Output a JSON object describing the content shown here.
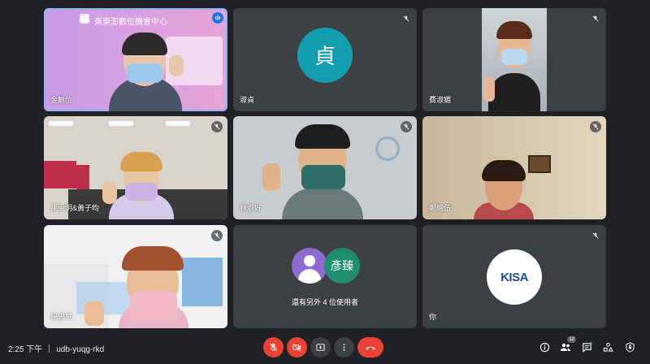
{
  "tiles": [
    {
      "name": "金數位",
      "banner": "東東澎數位機會中心"
    },
    {
      "name": "淑貞",
      "initial": "貞"
    },
    {
      "name": "費淑媚"
    },
    {
      "name": "孫園明&黃子昀"
    },
    {
      "name": "林淑好"
    },
    {
      "name": "鄭絢伍"
    },
    {
      "name": "楊思華"
    },
    {
      "others_initial": "彥臻",
      "others_text": "還有另外 4 位使用者"
    },
    {
      "name": "你",
      "logo": "KISA"
    }
  ],
  "bottom": {
    "time": "2:25 下午",
    "meeting_code": "udb-yuqg-rkd",
    "participant_count": "12"
  },
  "icons": {
    "tile_mute": "mic-off-icon",
    "speaking": "audio-level-icon",
    "controls": [
      "mic-off-icon",
      "camera-off-icon",
      "present-screen-icon",
      "more-options-icon",
      "hang-up-icon"
    ],
    "right": [
      "info-icon",
      "people-icon",
      "chat-icon",
      "activities-icon",
      "host-controls-icon"
    ]
  },
  "colors": {
    "background": "#202124",
    "tile": "#3c4043",
    "danger": "#ea4335",
    "active_border": "#8ab4f8",
    "avatar_teal": "#129eaf",
    "avatar_green": "#1e8e6e",
    "avatar_purple": "#8e6bd1"
  }
}
